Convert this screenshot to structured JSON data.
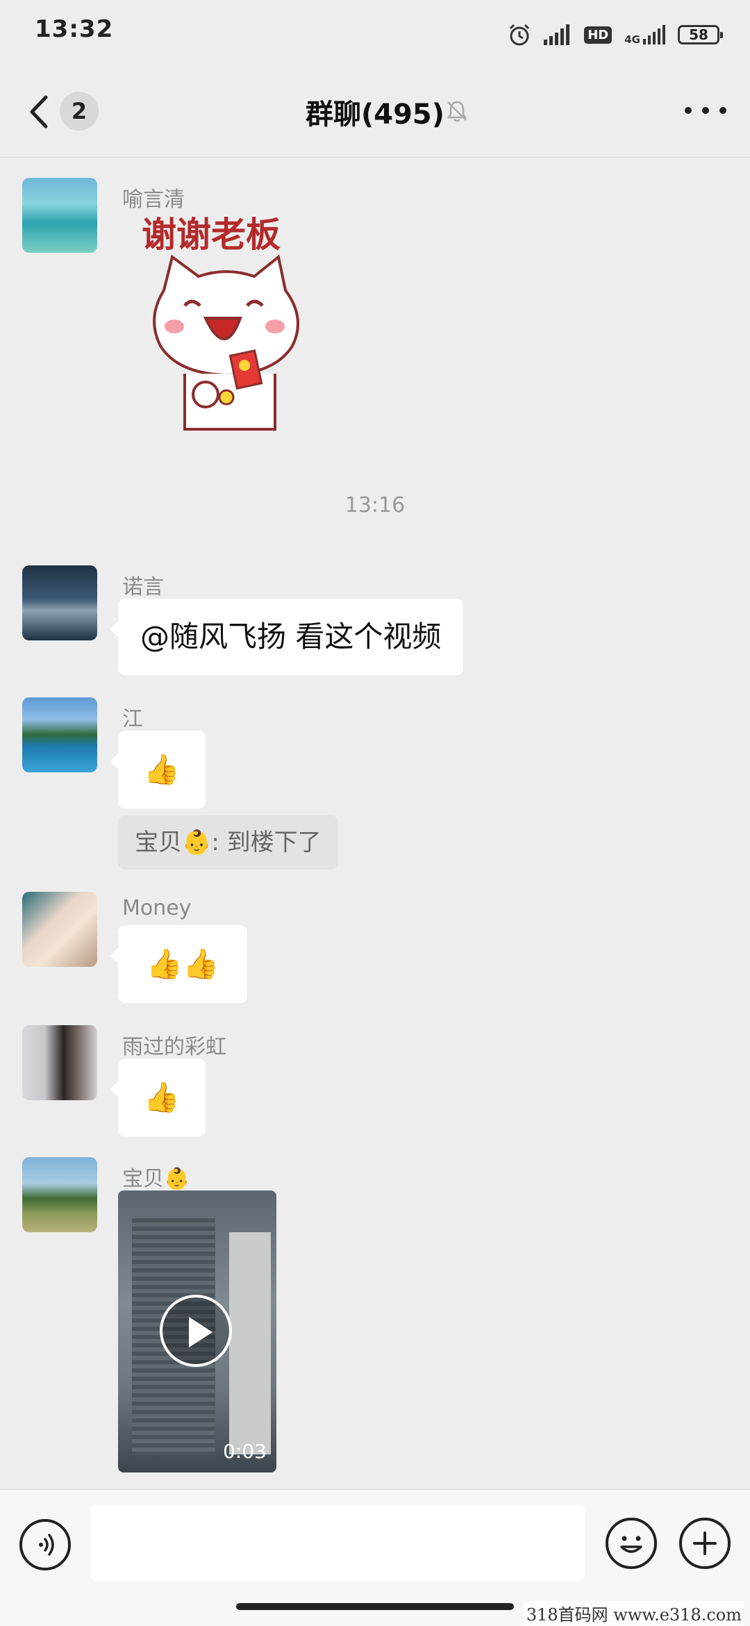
{
  "status_bar": {
    "time": "13:32",
    "network_hd": "HD",
    "network_type": "4G",
    "battery": "58"
  },
  "header": {
    "unread_count": "2",
    "title": "群聊(495)"
  },
  "messages": [
    {
      "sender": "喻言清",
      "type": "sticker",
      "sticker_text": "谢谢老板"
    },
    {
      "type": "timestamp",
      "text": "13:16"
    },
    {
      "sender": "诺言",
      "type": "text",
      "text": "@随风飞扬  看这个视频"
    },
    {
      "sender": "江",
      "type": "text",
      "text": "👍",
      "quote": "宝贝👶: 到楼下了"
    },
    {
      "sender": "Money",
      "type": "text",
      "text": "👍👍"
    },
    {
      "sender": "雨过的彩虹",
      "type": "text",
      "text": "👍"
    },
    {
      "sender": "宝贝👶",
      "type": "video",
      "duration": "0:03"
    }
  ],
  "input_bar": {
    "placeholder": ""
  },
  "watermark": "318首码网  www.e318.com",
  "colors": {
    "background": "#ededed",
    "bubble": "#ffffff",
    "sender_name": "#8a8a8a"
  }
}
